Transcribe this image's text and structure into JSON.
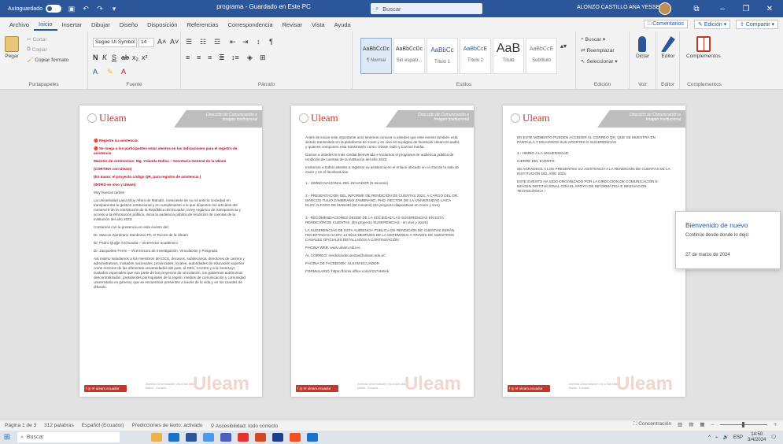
{
  "titlebar": {
    "autosave": "Autoguardado",
    "doc_title": "programa - Guardado en Este PC",
    "search": "Buscar",
    "user": "ALONZO CASTILLO ANA YESSENIA"
  },
  "menu": {
    "tabs": [
      "Archivo",
      "Inicio",
      "Insertar",
      "Dibujar",
      "Diseño",
      "Disposición",
      "Referencias",
      "Correspondencia",
      "Revisar",
      "Vista",
      "Ayuda"
    ],
    "active": "Inicio",
    "comments": "Comentarios",
    "edit": "Edición",
    "share": "Compartir"
  },
  "ribbon": {
    "paste": "Pegar",
    "cut": "Cortar",
    "copy": "Copiar",
    "format_painter": "Copiar formato",
    "font": "Segoe UI Symbol",
    "size": "14",
    "styles": [
      {
        "sample": "AaBbCcDc",
        "name": "¶ Normal"
      },
      {
        "sample": "AaBbCcDc",
        "name": "Sin espaci..."
      },
      {
        "sample": "AaBbCc",
        "name": "Título 1"
      },
      {
        "sample": "AaBbCcE",
        "name": "Título 2"
      },
      {
        "sample": "AaB",
        "name": "Título"
      },
      {
        "sample": "AaBbCcE",
        "name": "Subtítulo"
      }
    ],
    "find": "Buscar",
    "replace": "Reemplazar",
    "select": "Seleccionar",
    "dictate": "Dictar",
    "editor": "Editor",
    "addins": "Complementos",
    "groups": {
      "clipboard": "Portapapeles",
      "font": "Fuente",
      "paragraph": "Párrafo",
      "styles": "Estilos",
      "editing": "Edición",
      "voice": "Voz",
      "editor": "Editor",
      "addins": "Complementos"
    }
  },
  "pages": [
    {
      "logo": "Uleam",
      "band": "Dirección de Comunicación e Imagen Institucional",
      "paragraphs": [
        {
          "text": "🔴 Registre su asistencia:",
          "red": true
        },
        {
          "text": "🔴 Se ruega a los participantes estar atentos en las indicaciones para el registro de asistencia",
          "red": true
        },
        {
          "text": "Maestro de ceremonias: Mg. Yolanda Holloa – Secretaria General de la Uleam",
          "red": true
        },
        {
          "text": "(CORTINA con Uleam)",
          "red": true
        },
        {
          "text": "(En mano: el proyecto código QR, para registro de asistencia )",
          "red": true
        },
        {
          "text": "(INTRO en vivo y Uleam)",
          "red": true
        },
        {
          "text": "Muy buenas tardes",
          "red": false
        },
        {
          "text": "La Universidad Laica Eloy Alfaro de Manabí, consciente de su rol ante la sociedad en transparentar la gestión institucional y en cumplimiento a lo que disponen los artículos del numeral 6 de la constitución de la República del Ecuador, la ley orgánica de transparencia y acceso a la información pública, inicia la audiencia pública de rendición de cuentas de la institución del año 2023.",
          "red": false
        },
        {
          "text": "Contamos con la presencia en este evento del:",
          "red": false
        },
        {
          "text": "Dr. Marcos Zambrano Zambrano Ph. D Rector de la Uleam",
          "red": false
        },
        {
          "text": "Dr. Pedro Quijije Anchundia – Vicerrector académico",
          "red": false
        },
        {
          "text": "Dr. Jacqueline Ferrin – Vicerrectora de Investigación, Vinculación y Posgrado.",
          "red": false
        },
        {
          "text": "Así mismo saludamos a los miembros del OCS, decanos, subdecanos, directores de carrera y administrativos, invitados nacionales, provinciales, locales, autoridades de educación superior como rectores de las diferentes universidades del país, al CES, CACES y a la Senescyt, invitados especiales que son parte de los proyectos de vinculación, los gobiernos autónomos descentralizados, presidentes parroquiales de la región, medios de comunicación y comunidad universitaria en general, que se encuentran presentes a través de la vida y en los canales de difusión.",
          "red": false
        }
      ]
    },
    {
      "logo": "Uleam",
      "band": "Dirección de Comunicación e Imagen Institucional",
      "paragraphs": [
        {
          "text": "Antes de iniciar este importante acto tenemos conocer a ustedes que este evento también está siendo transmitido en la plataforma de zoom y en vivo en la página de facebook Uleam Ecuador, y quienes componen esta transmisión como: Uleam radio y Carmel media.",
          "red": false
        },
        {
          "text": "Damos a ustedes la más cordial bienvenida e iniciamos el programa de audiencia pública de rendición de cuentas de la institución del año 2023.",
          "red": false
        },
        {
          "text": "Invitamos a todos ustedes a registrar su asistencia en el enlace ubicado en el chat de la sala de zoom y en el facebook live.",
          "red": false
        },
        {
          "text": "1.- HIMNO NACIONAL DEL ECUADOR  (5 minutos)",
          "red": false
        },
        {
          "text": "2.- PRESENTACIÓN DEL INFORME DE RENDICIÓN DE CUENTAS 2023, A CARGO DEL DR. MARCOS TULIO ZAMBRANO ZAMBRANO, PHD, RECTOR DE LA UNIVERSIDAD LAICA ELOY ALFARO DE MANABÍ (60 minutos) (En proyecto diapositivas en zoom y vivo)",
          "red": false
        },
        {
          "text": "3.- RECOMENDACIONES DESDE DE LA SOCIEDAD LAS SUGERENCIAS EN ESTA RENDICIÓN DE CUENTAS. (En proyecto SUGERENCIAS - en vivo y zoom)",
          "red": false
        },
        {
          "text": "LA SUGERENCIAS DE ESTA AUDIENCIA PÚBLICA DE RENDICIÓN DE CUENTAS SERÁN RECEPTADAS HASTA 14 DÍAS DESPUÉS DE LA CEREMONIA A TRAVÉS DE NUESTROS CANALES OFICIALES DETALLADOS A CONTINUACIÓN:",
          "red": false
        },
        {
          "text": "PÁGINA WEB: www.uleam.edu.ec",
          "red": false
        },
        {
          "text": "AL CORREO: rendiciondecuentas@uleam.edu.ec",
          "red": false
        },
        {
          "text": "PÁGINA DE FACEBOOK: ULEAM ECUADOR",
          "red": false
        },
        {
          "text": "FORMULARIO: https://forms.office.com/r/1574H6Ak",
          "red": false
        }
      ]
    },
    {
      "logo": "Uleam",
      "band": "Dirección de Comunicación e Imagen Institucional",
      "paragraphs": [
        {
          "text": "EN ESTE MOMENTO PUEDEN ACCEDER AL CORREO QR, QUE SE MUESTRA EN PANTALLA Y DEJARNOS SUS APORTES O SUGERENCIAS",
          "red": false
        },
        {
          "text": "4.- HIMNO A LA UNIVERSIDAD",
          "red": false
        },
        {
          "text": "CIERRE DEL EVENTO:",
          "red": false
        },
        {
          "text": "SE AGRADECE A LOS PRESENTES SU ASISTENCIA A LA RENDICIÓN DE CUENTAS DE LA INSTITUCIÓN DEL AÑO 2023.",
          "red": false
        },
        {
          "text": "ESTE EVENTO HA SIDO ORGANIZADO POR LA DIRECCIÓN DE COMUNICACIÓN E IMAGEN INSTITUCIONAL CON EL APOYO DE INFORMÁTICA E INNOVACIÓN TECNOLÓGICA !",
          "red": false
        }
      ]
    }
  ],
  "footer": {
    "watermark": "Uleam",
    "social": "f ◎ ✉ uleam.ecuador",
    "address": "Avenida Circunvalación Vía a San Mateo · Manta - Ecuador"
  },
  "toast": {
    "title": "Bienvenido de nuevo",
    "subtitle": "Continúe desde donde lo dejó:",
    "date": "27 de marzo de 2024"
  },
  "status": {
    "page": "Página 1 de 3",
    "words": "312 palabras",
    "language": "Español (Ecuador)",
    "predictions": "Predicciones de texto: activado",
    "accessibility": "Accesibilidad: todo correcto",
    "focus": "Concentración"
  },
  "taskbar": {
    "search": "Buscar",
    "time": "14:50",
    "date": "3/4/2024",
    "lang": "ESP"
  },
  "colors": {
    "accent": "#2b579a",
    "brand_red": "#c0392b"
  }
}
